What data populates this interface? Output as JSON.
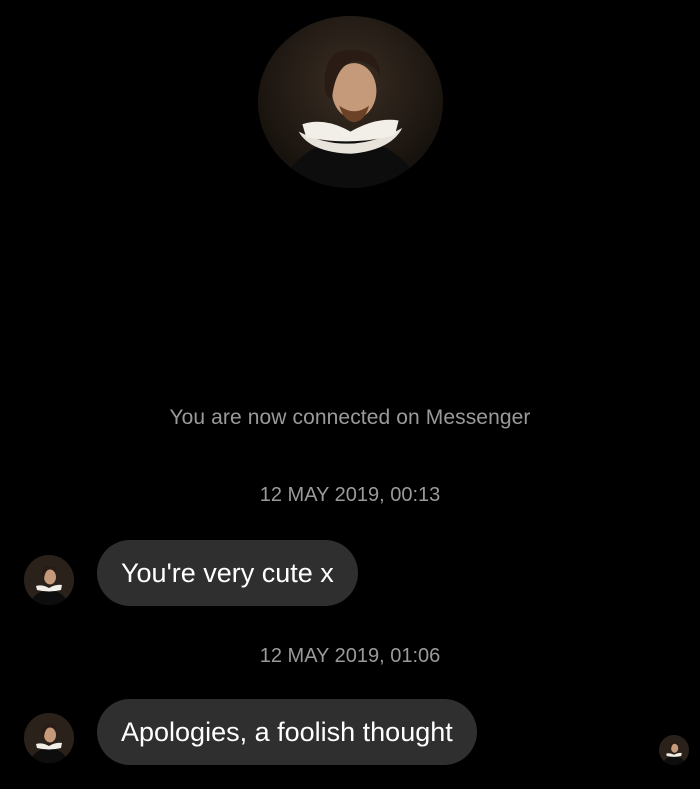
{
  "profile": {
    "avatar_icon": "portrait-avatar-icon"
  },
  "thread": {
    "connected_notice": "You are now connected on Messenger",
    "messages": [
      {
        "timestamp": "12 MAY 2019, 00:13",
        "text": "You're very cute x"
      },
      {
        "timestamp": "12 MAY 2019, 01:06",
        "text": "Apologies, a foolish thought"
      }
    ],
    "seen_indicator_icon": "seen-avatar-icon"
  },
  "colors": {
    "background": "#000000",
    "bubble": "#2f2f2f",
    "meta_text": "#9a9a9a",
    "bubble_text": "#ffffff"
  }
}
